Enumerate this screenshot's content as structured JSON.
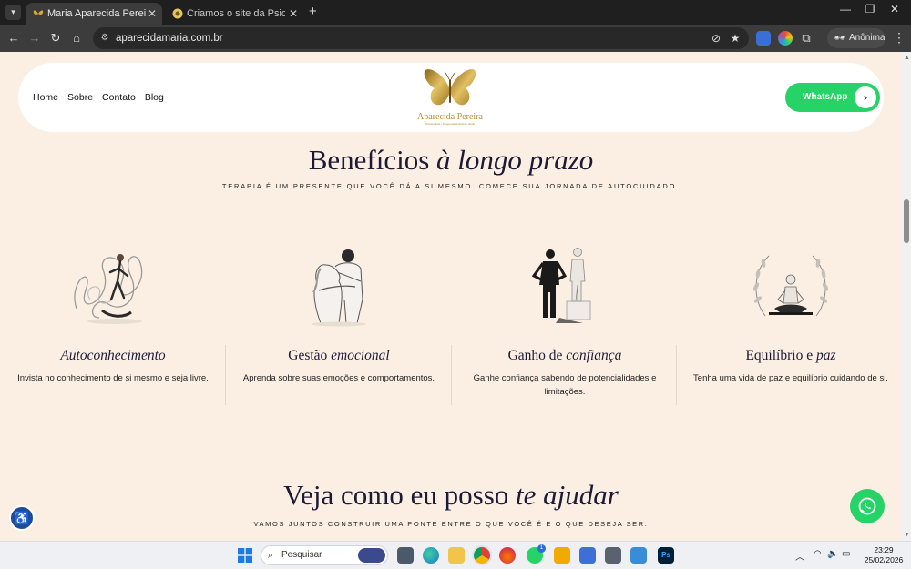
{
  "browser": {
    "tabs": [
      {
        "title": "Maria Aparecida Pereira da Silva",
        "active": true
      },
      {
        "title": "Criamos o site da Psicanalista M",
        "active": false
      }
    ],
    "url": "aparecidamaria.com.br",
    "profile_label": "Anônima"
  },
  "site": {
    "nav": [
      "Home",
      "Sobre",
      "Contato",
      "Blog"
    ],
    "logo_name": "Aparecida Pereira",
    "logo_tagline": "Psicanalista • Terapeuta Holística • Reiki",
    "whatsapp_label": "WhatsApp",
    "hero_title_plain": "Benefícios ",
    "hero_title_italic": "à longo prazo",
    "hero_subtitle": "TERAPIA É UM PRESENTE QUE VOCÊ DÁ A SI MESMO. COMECE SUA JORNADA DE AUTOCUIDADO.",
    "benefits": [
      {
        "title_plain": "",
        "title_italic": "Autoconhecimento",
        "desc": "Invista no conhecimento de si mesmo e seja livre."
      },
      {
        "title_plain": "Gestão ",
        "title_italic": "emocional",
        "desc": "Aprenda sobre suas emoções e comportamentos."
      },
      {
        "title_plain": "Ganho de ",
        "title_italic": "confiança",
        "desc": "Ganhe confiança sabendo de potencialidades e limitações."
      },
      {
        "title_plain": "Equilíbrio e ",
        "title_italic": "paz",
        "desc": "Tenha uma vida de paz e equilíbrio cuidando de si."
      }
    ],
    "section2_title_plain": "Veja como eu posso ",
    "section2_title_italic": "te ajudar",
    "section2_subtitle": "VAMOS JUNTOS CONSTRUIR UMA PONTE ENTRE O QUE VOCÊ É E O QUE DESEJA SER."
  },
  "taskbar": {
    "search_placeholder": "Pesquisar",
    "whatsapp_badge": "1",
    "time": "23:29",
    "date": "25/02/2026"
  },
  "colors": {
    "page_bg": "#fbefe3",
    "heading": "#1d1a36",
    "gold": "#b58d2c",
    "whatsapp_green": "#25d366"
  }
}
